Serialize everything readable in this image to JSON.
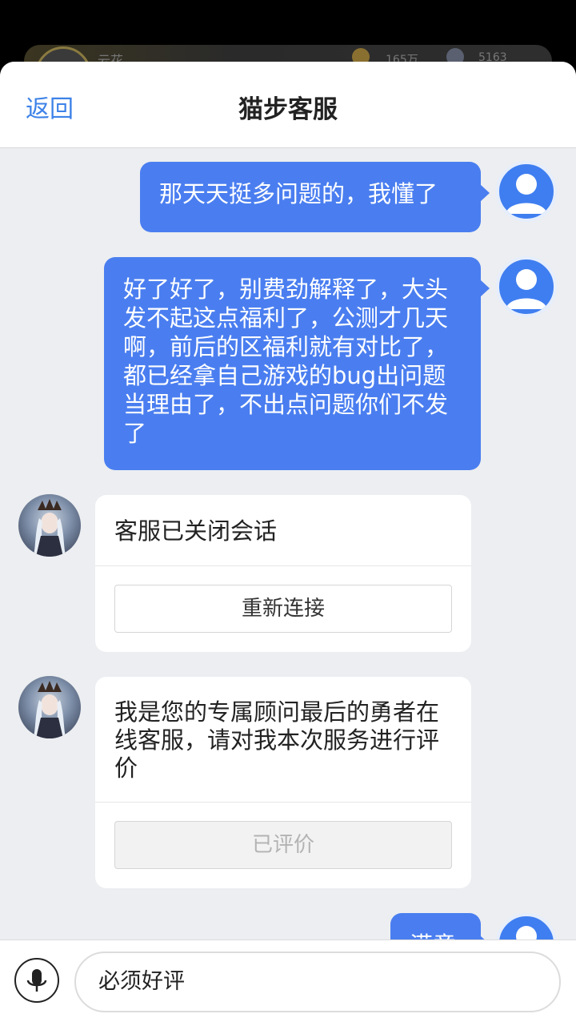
{
  "background_game": {
    "player_name": "云花",
    "coins": "165万",
    "gems": "5163"
  },
  "header": {
    "back_label": "返回",
    "title": "猫步客服"
  },
  "messages": [
    {
      "from": "user",
      "text": "那天天挺多问题的，我懂了"
    },
    {
      "from": "user",
      "text": "好了好了，别费劲解释了，大头发不起这点福利了，公测才几天啊，前后的区福利就有对比了，都已经拿自己游戏的bug出问题当理由了，不出点问题你们不发了"
    },
    {
      "from": "agent",
      "text": "客服已关闭会话",
      "button": "重新连接"
    },
    {
      "from": "agent",
      "text": "我是您的专属顾问最后的勇者在线客服，请对我本次服务进行评价",
      "button": "已评价"
    },
    {
      "from": "user",
      "text": "满意"
    }
  ],
  "footer": {
    "input_value": "必须好评"
  },
  "colors": {
    "accent": "#4a7ef0",
    "link": "#3d82e8",
    "chat_bg": "#eceef1"
  },
  "icons": {
    "user_avatar": "person-icon",
    "mic": "microphone-icon"
  }
}
